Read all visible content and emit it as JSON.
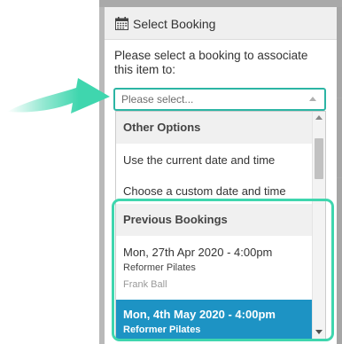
{
  "dialog": {
    "title": "Select Booking",
    "title_icon": "calendar-icon",
    "prompt": "Please select a booking to associate this item to:"
  },
  "select": {
    "placeholder": "Please select..."
  },
  "dropdown": {
    "other_options": {
      "label": "Other Options",
      "items": [
        "Use the current date and time",
        "Choose a custom date and time"
      ]
    },
    "previous_bookings": {
      "label": "Previous Bookings",
      "items": [
        {
          "date": "Mon, 27th Apr 2020 - 4:00pm",
          "class": "Reformer Pilates",
          "instructor": "Frank Ball",
          "selected": false
        },
        {
          "date": "Mon, 4th May 2020 - 4:00pm",
          "class": "Reformer Pilates",
          "selected": true
        }
      ]
    }
  },
  "colors": {
    "accent_teal": "#3fd6ae",
    "select_border": "#2cb5a4",
    "selected_row": "#1d93c4",
    "backdrop": "#b9b9b9"
  },
  "annotations": {
    "pointer_arrow": "arrow-icon"
  }
}
